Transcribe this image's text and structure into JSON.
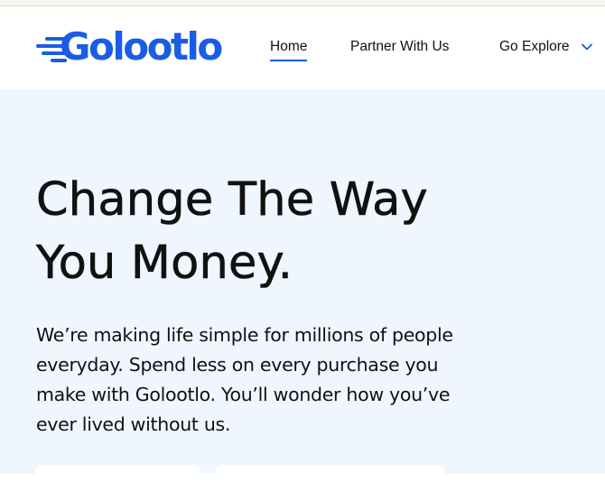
{
  "brand": {
    "logo_text": "Golootlo",
    "accent_color": "#1a5ce6"
  },
  "nav": {
    "items": [
      {
        "label": "Home",
        "active": true
      },
      {
        "label": "Partner With Us",
        "active": false
      },
      {
        "label": "Go Explore",
        "active": false,
        "icon": "chevron-down-icon"
      }
    ]
  },
  "hero": {
    "title_line1": "Change The Way",
    "title_line2": "You Money.",
    "description": "We’re making life simple for millions of people everyday. Spend less on every purchase you make with Golootlo. You’ll wonder how you’ve ever lived without us.",
    "background_color": "#eff6fd"
  }
}
